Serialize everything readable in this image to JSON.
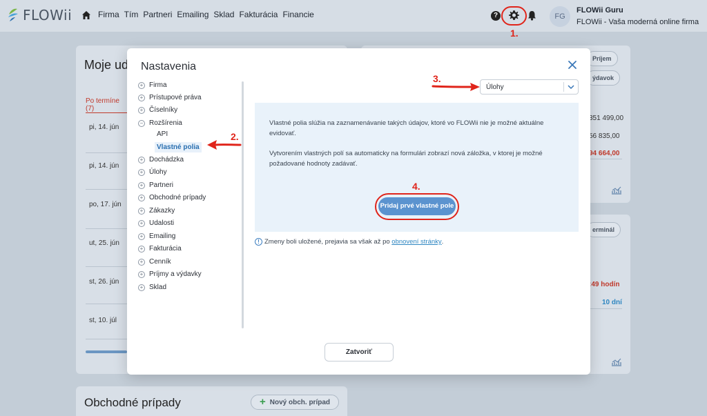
{
  "app": {
    "logo_text": "FLOWii"
  },
  "nav": {
    "items": [
      "Firma",
      "Tím",
      "Partneri",
      "Emailing",
      "Sklad",
      "Fakturácia",
      "Financie"
    ]
  },
  "header": {
    "help_label": "?",
    "avatar_initials": "FG",
    "user_name": "FLOWii Guru",
    "user_company": "FLOWii - Vaša moderná online firma",
    "step1_label": "1.",
    "icons": [
      "home-icon",
      "help-icon",
      "gear-icon",
      "bell-icon"
    ]
  },
  "dashboard": {
    "left_card": {
      "title": "Moje ud",
      "term_tab": "Po termíne (7)",
      "dates": [
        "pi, 14. jún",
        "pi, 14. jún",
        "po, 17. jún",
        "ut, 25. jún",
        "st, 26. jún",
        "st, 10. júl"
      ]
    },
    "right_card_top": {
      "pills": [
        "Príjem",
        "ýdavok"
      ],
      "values": [
        "351 499,00",
        "56 835,00",
        "94 664,00"
      ]
    },
    "right_card_bottom": {
      "pill": "erminál",
      "hours": ":49 hodín",
      "days": "10 dní"
    },
    "bottom_card": {
      "title": "Obchodné prípady",
      "add_button": "Nový obch. prípad"
    }
  },
  "modal": {
    "title": "Nastavenia",
    "tree": [
      "Firma",
      "Prístupové práva",
      "Číselníky",
      "Rozšírenia"
    ],
    "tree_sub": [
      "API",
      "Vlastné polia"
    ],
    "tree_rest": [
      "Dochádzka",
      "Úlohy",
      "Partneri",
      "Obchodné prípady",
      "Zákazky",
      "Udalosti",
      "Emailing",
      "Fakturácia",
      "Cenník",
      "Príjmy a výdavky",
      "Sklad"
    ],
    "select_value": "Úlohy",
    "info_paragraph_1_line_1": "Vlastné polia slúžia na zaznamenávanie takých údajov, ktoré vo FLOWii nie je možné aktuálne",
    "info_paragraph_1_line_2": "evidovať.",
    "info_paragraph_2_line_1": "Vytvorením vlastných polí sa automaticky na formulári zobrazí nová záložka, v ktorej je možné",
    "info_paragraph_2_line_2": "požadované hodnoty zadávať.",
    "primary_button": "Pridaj prvé vlastné pole",
    "note_text": "Zmeny boli uložené, prejavia sa však až po",
    "note_link": "obnovení stránky",
    "note_end": ".",
    "close_button": "Zatvoriť",
    "step2_label": "2.",
    "step3_label": "3.",
    "step4_label": "4."
  },
  "colors": {
    "annotation_red": "#e0241a",
    "primary_blue": "#5b93cf",
    "link_blue": "#2e86c1"
  }
}
